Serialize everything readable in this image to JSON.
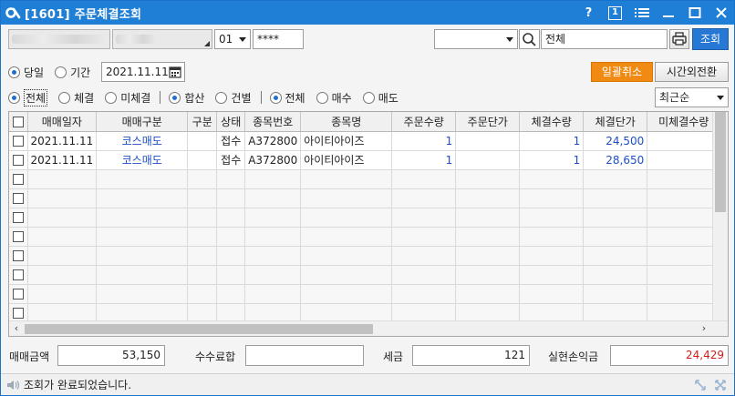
{
  "window": {
    "title": "[1601] 주문체결조회",
    "help_label": "?",
    "screen_num_label": "1"
  },
  "top_row": {
    "account_select": "01",
    "password_mask": "****",
    "search_value": "전체",
    "query_button": "조회"
  },
  "filters": {
    "date_options": [
      "당일",
      "기간"
    ],
    "date_selected": 0,
    "date_value": "2021.11.11",
    "cancel_all_button": "일괄취소",
    "after_hours_button": "시간외전환",
    "exec_options": [
      "전체",
      "체결",
      "미체결"
    ],
    "exec_selected": 0,
    "sum_options": [
      "합산",
      "건별"
    ],
    "sum_selected": 0,
    "side_options": [
      "전체",
      "매수",
      "매도"
    ],
    "side_selected": 0,
    "sort_select": "최근순"
  },
  "table": {
    "headers": [
      "매매일자",
      "매매구분",
      "구분",
      "상태",
      "종목번호",
      "종목명",
      "주문수량",
      "주문단가",
      "체결수량",
      "체결단가",
      "미체결수량"
    ],
    "rows": [
      [
        "2021.11.11",
        "코스매도",
        "",
        "접수",
        "A372800",
        "아이티아이즈",
        "1",
        "",
        "1",
        "24,500",
        ""
      ],
      [
        "2021.11.11",
        "코스매도",
        "",
        "접수",
        "A372800",
        "아이티아이즈",
        "1",
        "",
        "1",
        "28,650",
        ""
      ]
    ],
    "empty_rows": 8
  },
  "summary": {
    "trade_amount_label": "매매금액",
    "trade_amount": "53,150",
    "fee_label": "수수료합",
    "fee": "",
    "tax_label": "세금",
    "tax": "121",
    "pnl_label": "실현손익금",
    "pnl": "24,429"
  },
  "status": {
    "message": "조회가 완료되었습니다."
  },
  "colors": {
    "titlebar": "#1f7fd6",
    "accent_orange": "#f08a12",
    "query_blue": "#2778d4",
    "value_blue": "#1d4fc4",
    "pnl_red": "#d41c1c"
  }
}
